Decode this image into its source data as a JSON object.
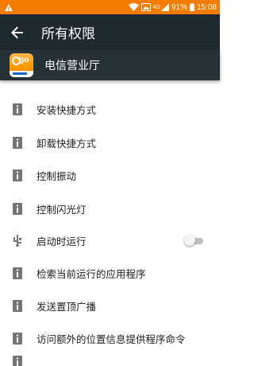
{
  "status_bar": {
    "battery": "91%",
    "time": "15:08",
    "network": "4G",
    "background": "#f57c00"
  },
  "app_bar": {
    "title": "所有权限",
    "back_icon": "arrow-back-icon",
    "background": "#1f2a30"
  },
  "app": {
    "name": "电信营业厅",
    "logo_icon": "telecom-ego-logo"
  },
  "permissions": [
    {
      "label": "安装快捷方式",
      "icon": "info-icon"
    },
    {
      "label": "卸载快捷方式",
      "icon": "info-icon"
    },
    {
      "label": "控制振动",
      "icon": "info-icon"
    },
    {
      "label": "控制闪光灯",
      "icon": "info-icon"
    },
    {
      "label": "启动时运行",
      "icon": "usb-icon",
      "toggle": false
    },
    {
      "label": "检索当前运行的应用程序",
      "icon": "info-icon"
    },
    {
      "label": "发送置顶广播",
      "icon": "info-icon"
    },
    {
      "label": "访问额外的位置信息提供程序命令",
      "icon": "info-icon"
    }
  ]
}
